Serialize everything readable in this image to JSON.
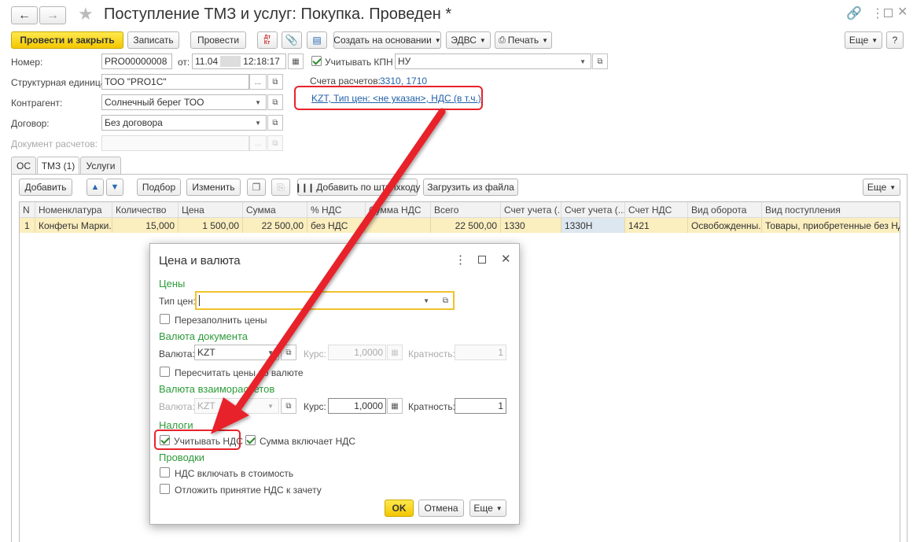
{
  "title": "Поступление ТМЗ и услуг: Покупка. Проведен *",
  "toolbar": {
    "post_close": "Провести и закрыть",
    "save": "Записать",
    "post": "Провести",
    "dtkt": "Дт Кт",
    "create_based": "Создать на основании",
    "edvs": "ЭДВС",
    "print": "Печать",
    "more": "Еще",
    "help": "?"
  },
  "form": {
    "number_label": "Номер:",
    "number_value": "PRO00000008",
    "date_label": "от:",
    "date_value": "11.04",
    "time_value": "12:18:17",
    "kpn_label": "Учитывать КПН",
    "kpn_value": "НУ",
    "struct_label": "Структурная единица:",
    "struct_value": "ТОО \"PRO1C\"",
    "accounts_label": "Счета расчетов:",
    "accounts_value": "3310, 1710",
    "price_link": "KZT, Тип цен: <не указан>, НДС (в т.ч.)",
    "contractor_label": "Контрагент:",
    "contractor_value": "Солнечный берег ТОО",
    "contract_label": "Договор:",
    "contract_value": "Без договора",
    "settle_doc_label": "Документ расчетов:"
  },
  "tabs": [
    "ОС",
    "ТМЗ (1)",
    "Услуги"
  ],
  "table_toolbar": {
    "add": "Добавить",
    "select": "Подбор",
    "change": "Изменить",
    "barcode": "Добавить по штрихкоду",
    "load": "Загрузить из файла",
    "more": "Еще"
  },
  "table": {
    "headers": [
      "N",
      "Номенклатура",
      "Количество",
      "Цена",
      "Сумма",
      "% НДС",
      "Сумма НДС",
      "Всего",
      "Счет учета (...",
      "Счет учета (...",
      "Счет НДС",
      "Вид оборота",
      "Вид поступления"
    ],
    "row": [
      "1",
      "Конфеты Марки...",
      "15,000",
      "1 500,00",
      "22 500,00",
      "без НДС",
      "",
      "22 500,00",
      "1330",
      "1330Н",
      "1421",
      "Освобожденны...",
      "Товары, приобретенные без НДС"
    ]
  },
  "dialog": {
    "title": "Цена и валюта",
    "sec_prices": "Цены",
    "price_type_label": "Тип цен:",
    "refill_prices": "Перезаполнить цены",
    "sec_doc_currency": "Валюта документа",
    "currency_label": "Валюта:",
    "currency_value": "KZT",
    "rate_label": "Курс:",
    "rate_value": "1,0000",
    "mult_label": "Кратность:",
    "mult_value": "1",
    "recalc_prices": "Пересчитать цены по валюте",
    "sec_settle_currency": "Валюта взаиморасчетов",
    "settle_currency_value": "KZT",
    "settle_rate_value": "1,0000",
    "settle_mult_value": "1",
    "sec_taxes": "Налоги",
    "consider_vat": "Учитывать НДС",
    "sum_includes_vat": "Сумма включает НДС",
    "sec_postings": "Проводки",
    "vat_in_cost": "НДС включать в стоимость",
    "defer_vat": "Отложить принятие НДС к зачету",
    "ok": "OK",
    "cancel": "Отмена",
    "more": "Еще"
  },
  "colors": {
    "accent_green": "#2d9b3a",
    "highlight_red": "#e8232a",
    "yellow_button": "#f3c700"
  }
}
